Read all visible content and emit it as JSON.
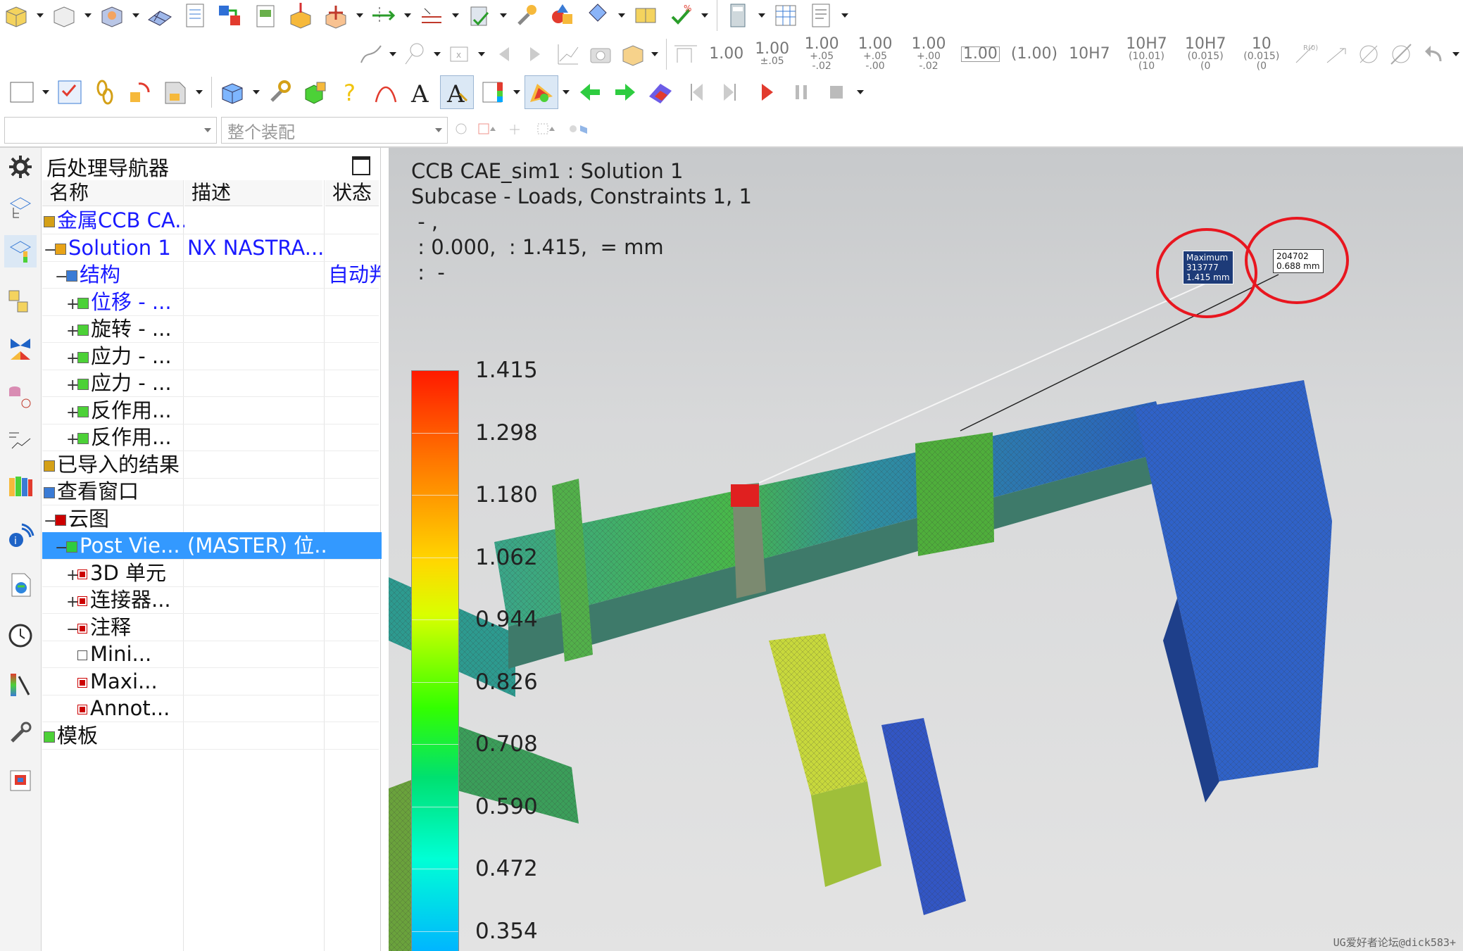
{
  "toolbar": {
    "dims": [
      {
        "main": "1.00",
        "sub": ""
      },
      {
        "main": "1.00",
        "sub": "±.05"
      },
      {
        "main": "1.00",
        "sub": "+.05 -.02"
      },
      {
        "main": "1.00",
        "sub": "+.05 -.00"
      },
      {
        "main": "1.00",
        "sub": "+.00 -.02"
      },
      {
        "main": "1.00",
        "sub": ""
      },
      {
        "main": "(1.00)",
        "sub": ""
      },
      {
        "main": "10H7",
        "sub": ""
      },
      {
        "main": "10H7",
        "sub": "(10.01) (10"
      },
      {
        "main": "10H7",
        "sub": "(0.015) (0"
      },
      {
        "main": "10",
        "sub": "(0.015) (0"
      }
    ],
    "assembly_placeholder": "整个装配"
  },
  "navigator": {
    "title": "后处理导航器",
    "columns": [
      "名称",
      "描述",
      "状态"
    ],
    "rows": [
      {
        "name": "金属CCB CA...",
        "desc": "",
        "status": "",
        "indent": 0,
        "blue": true,
        "pm": "",
        "cb": ""
      },
      {
        "name": "Solution 1",
        "desc": "NX NASTRA...",
        "status": "",
        "indent": 0,
        "blue": true,
        "pm": "−",
        "cb": ""
      },
      {
        "name": "结构",
        "desc": "",
        "status": "自动判",
        "indent": 1,
        "blue": true,
        "pm": "−",
        "cb": ""
      },
      {
        "name": "位移 - ...",
        "desc": "",
        "status": "",
        "indent": 2,
        "blue": true,
        "pm": "+",
        "cb": ""
      },
      {
        "name": "旋转 - ...",
        "desc": "",
        "status": "",
        "indent": 2,
        "blue": false,
        "pm": "+",
        "cb": ""
      },
      {
        "name": "应力 - ...",
        "desc": "",
        "status": "",
        "indent": 2,
        "blue": false,
        "pm": "+",
        "cb": ""
      },
      {
        "name": "应力 - ...",
        "desc": "",
        "status": "",
        "indent": 2,
        "blue": false,
        "pm": "+",
        "cb": ""
      },
      {
        "name": "反作用...",
        "desc": "",
        "status": "",
        "indent": 2,
        "blue": false,
        "pm": "+",
        "cb": ""
      },
      {
        "name": "反作用...",
        "desc": "",
        "status": "",
        "indent": 2,
        "blue": false,
        "pm": "+",
        "cb": ""
      },
      {
        "name": "已导入的结果",
        "desc": "",
        "status": "",
        "indent": 0,
        "blue": false,
        "pm": "",
        "cb": ""
      },
      {
        "name": "查看窗口",
        "desc": "",
        "status": "",
        "indent": 0,
        "blue": false,
        "pm": "",
        "cb": ""
      },
      {
        "name": "云图",
        "desc": "",
        "status": "",
        "indent": 0,
        "blue": false,
        "pm": "−",
        "cb": ""
      },
      {
        "name": "Post Vie...",
        "desc": "(MASTER) 位...",
        "status": "",
        "indent": 1,
        "blue": false,
        "pm": "−",
        "cb": "",
        "selected": true
      },
      {
        "name": "3D 单元",
        "desc": "",
        "status": "",
        "indent": 2,
        "blue": false,
        "pm": "+",
        "cb": "on"
      },
      {
        "name": "连接器...",
        "desc": "",
        "status": "",
        "indent": 2,
        "blue": false,
        "pm": "+",
        "cb": "on"
      },
      {
        "name": "注释",
        "desc": "",
        "status": "",
        "indent": 2,
        "blue": false,
        "pm": "−",
        "cb": "on"
      },
      {
        "name": "Mini...",
        "desc": "",
        "status": "",
        "indent": 3,
        "blue": false,
        "pm": "",
        "cb": "off"
      },
      {
        "name": "Maxi...",
        "desc": "",
        "status": "",
        "indent": 3,
        "blue": false,
        "pm": "",
        "cb": "on"
      },
      {
        "name": "Annot...",
        "desc": "",
        "status": "",
        "indent": 3,
        "blue": false,
        "pm": "",
        "cb": "on"
      },
      {
        "name": "模板",
        "desc": "",
        "status": "",
        "indent": 0,
        "blue": false,
        "pm": "",
        "cb": ""
      }
    ]
  },
  "viewport": {
    "header_lines": [
      "CCB CAE_sim1 : Solution 1",
      "Subcase - Loads, Constraints 1,  1",
      " - ,",
      " : 0.000,  : 1.415,  = mm",
      " :  -"
    ],
    "max_label": {
      "title": "Maximum",
      "id": "313777",
      "value": "1.415 mm"
    },
    "probe_label": {
      "id": "204702",
      "value": "0.688 mm"
    },
    "legend_values": [
      "1.415",
      "1.298",
      "1.180",
      "1.062",
      "0.944",
      "0.826",
      "0.708",
      "0.590",
      "0.472",
      "0.354"
    ],
    "legend_colors": {
      "max": "#ff1a00",
      "mid": "#33ff00",
      "min": "#00b5ff"
    },
    "watermark": "UG爱好者论坛@dick583+"
  },
  "colors": {
    "accent_selection": "#3399ff",
    "annotation_circle": "#e8161f",
    "tree_blue": "#1a1aff"
  }
}
